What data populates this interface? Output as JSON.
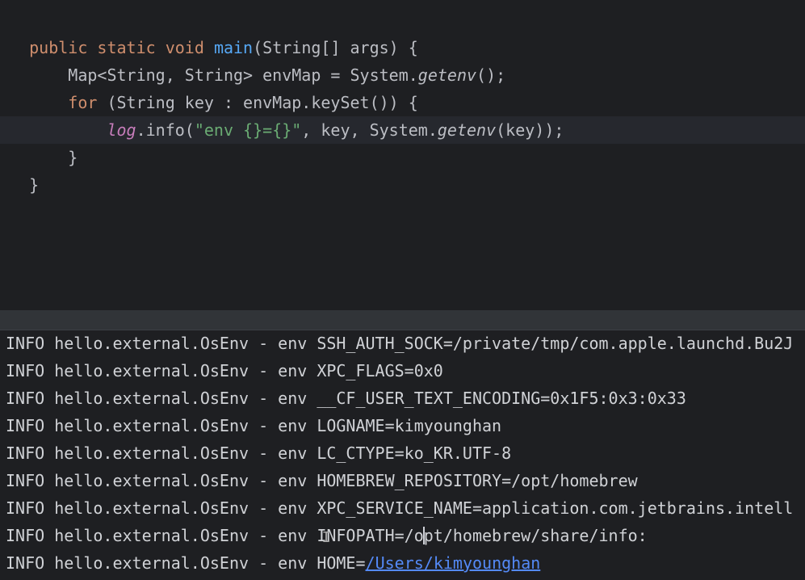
{
  "editor": {
    "line1": {
      "kw1": "public",
      "kw2": "static",
      "kw3": "void",
      "fn": "main",
      "rest": "(String[] args) {"
    },
    "line2": {
      "a": "Map<String, String> envMap = System.",
      "b": "getenv",
      "c": "();"
    },
    "line3": {
      "kw": "for",
      "rest": " (String key : envMap.keySet()) {"
    },
    "line4": {
      "log": "log",
      "a": ".info(",
      "str": "\"env {}={}\"",
      "b": ", key, System.",
      "c": "getenv",
      "d": "(key));"
    },
    "line5": "}",
    "line6": "}"
  },
  "console": {
    "prefix": "INFO hello.external.OsEnv - env ",
    "rows": [
      "SSH_AUTH_SOCK=/private/tmp/com.apple.launchd.Bu2J",
      "XPC_FLAGS=0x0",
      "__CF_USER_TEXT_ENCODING=0x1F5:0x3:0x33",
      "LOGNAME=kimyounghan",
      "LC_CTYPE=ko_KR.UTF-8",
      "HOMEBREW_REPOSITORY=/opt/homebrew",
      "XPC_SERVICE_NAME=application.com.jetbrains.intell"
    ],
    "infopath": {
      "a": "INFOPATH=/o",
      "b": "pt/homebrew/share/info:"
    },
    "home": {
      "key": "HOME=",
      "link": "/Users/kimyounghan"
    }
  }
}
